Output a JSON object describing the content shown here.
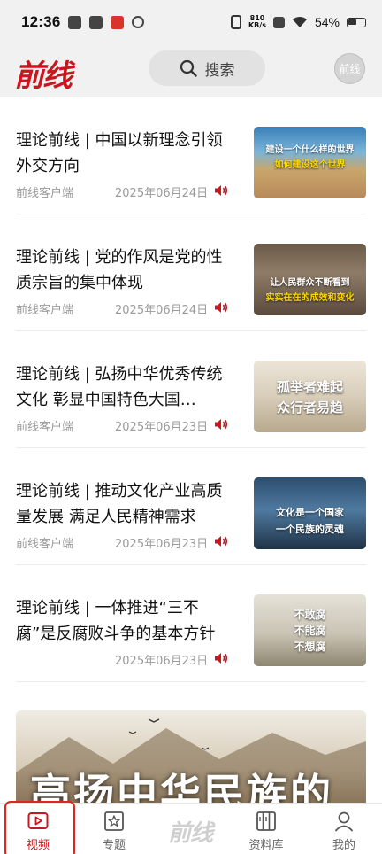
{
  "status_bar": {
    "time": "12:36",
    "net_speed_value": "810",
    "net_speed_unit": "KB/s",
    "battery": "54%"
  },
  "header": {
    "logo": "前线",
    "search_label": "搜索",
    "avatar_text": "前线"
  },
  "articles": [
    {
      "title": "理论前线 | 中国以新理念引领外交方向",
      "source": "前线客户端",
      "date": "2025年06月24日",
      "thumb_lines": [
        "建设一个什么样的世界",
        "如何建设这个世界"
      ]
    },
    {
      "title": "理论前线 | 党的作风是党的性质宗旨的集中体现",
      "source": "前线客户端",
      "date": "2025年06月24日",
      "thumb_lines": [
        "让人民群众不断看到",
        "实实在在的成效和变化"
      ]
    },
    {
      "title": "理论前线 | 弘扬中华优秀传统文化 彰显中国特色大国…",
      "source": "前线客户端",
      "date": "2025年06月23日",
      "thumb_lines": [
        "孤举者难起",
        "众行者易趋"
      ]
    },
    {
      "title": "理论前线 | 推动文化产业高质量发展 满足人民精神需求",
      "source": "前线客户端",
      "date": "2025年06月23日",
      "thumb_lines": [
        "文化是一个国家",
        "一个民族的灵魂"
      ]
    },
    {
      "title": "理论前线 | 一体推进“三不腐”是反腐败斗争的基本方针",
      "source": "",
      "date": "2025年06月23日",
      "thumb_lines": [
        "不敢腐",
        "不能腐",
        "不想腐"
      ]
    }
  ],
  "banner": {
    "text": "高扬中华民族的"
  },
  "tabs": [
    {
      "label": "视频",
      "active": true
    },
    {
      "label": "专题",
      "active": false
    },
    {
      "label": "前线",
      "active": false
    },
    {
      "label": "资料库",
      "active": false
    },
    {
      "label": "我的",
      "active": false
    }
  ],
  "colors": {
    "brand_red": "#c8171e",
    "highlight_yellow": "#ffd800"
  }
}
